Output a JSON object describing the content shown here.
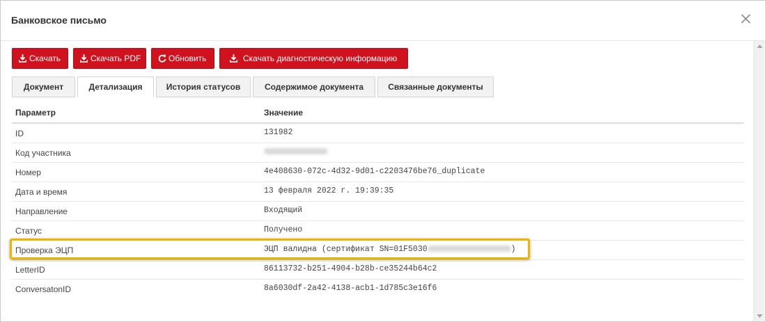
{
  "modal": {
    "title": "Банковское письмо"
  },
  "toolbar": {
    "download_label": "Скачать",
    "download_pdf_label": "Скачать PDF",
    "refresh_label": "Обновить",
    "download_diag_label": "Скачать диагностическую информацию"
  },
  "tabs": [
    {
      "label": "Документ",
      "active": false
    },
    {
      "label": "Детализация",
      "active": true
    },
    {
      "label": "История статусов",
      "active": false
    },
    {
      "label": "Содержимое документа",
      "active": false
    },
    {
      "label": "Связанные документы",
      "active": false
    }
  ],
  "table": {
    "headers": {
      "param": "Параметр",
      "value": "Значение"
    },
    "rows": [
      {
        "param": "ID",
        "value": "131982"
      },
      {
        "param": "Код участника",
        "value": ""
      },
      {
        "param": "Номер",
        "value": "4e408630-072c-4d32-9d01-c2203476be76_duplicate"
      },
      {
        "param": "Дата и время",
        "value": "13 февраля 2022 г. 19:39:35"
      },
      {
        "param": "Направление",
        "value": "Входящий"
      },
      {
        "param": "Статус",
        "value": "Получено"
      },
      {
        "param": "Проверка ЭЦП",
        "value": "ЭЦП валидна (сертификат SN=01F5030",
        "value_suffix": ")"
      },
      {
        "param": "LetterID",
        "value": "86113732-b251-4904-b28b-ce35244b64c2"
      },
      {
        "param": "ConversatonID",
        "value": "8a6030df-2a42-4138-acb1-1d785c3e16f6"
      }
    ]
  },
  "colors": {
    "accent": "#d0121f",
    "highlight": "#f0b400"
  }
}
